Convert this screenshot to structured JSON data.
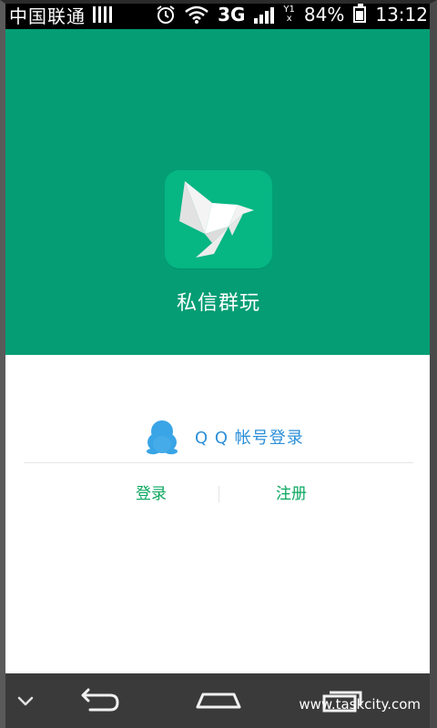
{
  "status_bar": {
    "carrier": "中国联通",
    "network": "3G",
    "battery": "84%",
    "time": "13:12",
    "mini_labels": {
      "top": "Y1",
      "bottom": "x"
    }
  },
  "app": {
    "name": "私信群玩"
  },
  "login": {
    "qq_label": "Q Q 帐号登录",
    "login_link": "登录",
    "register_link": "注册"
  },
  "nav": {
    "watermark": "www.taskcity.com"
  },
  "colors": {
    "header_green": "#049d74",
    "icon_green": "#06b683",
    "link_green": "#0aa75f",
    "qq_blue": "#2c8fd8"
  },
  "icons": {
    "status": [
      "sim-icon",
      "alarm-icon",
      "wifi-icon",
      "signal-icon",
      "battery-icon"
    ],
    "app": "dove-icon",
    "qq": "qq-penguin-icon",
    "nav": [
      "chevron-down-icon",
      "back-icon",
      "home-icon",
      "recent-apps-icon"
    ]
  }
}
